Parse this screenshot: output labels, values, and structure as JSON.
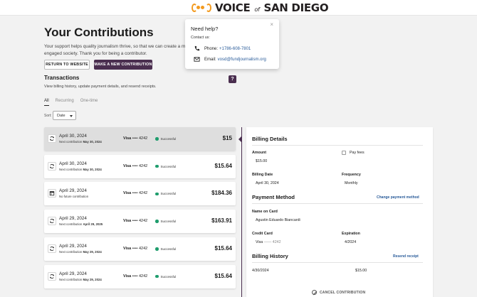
{
  "header": {
    "logo_text_main": "VOICE",
    "logo_text_of": "of",
    "logo_text_end": "SAN DIEGO"
  },
  "intro": {
    "title": "Your Contributions",
    "text": "Your support helps quality journalism thrive, so that we can create a m engaged society. Thank you for being a contributor.",
    "return_button": "RETURN TO WEBSITE",
    "new_button": "MAKE A NEW CONTRIBUTION"
  },
  "help_badge": "?",
  "transactions": {
    "title": "Transactions",
    "subtitle": "View billing history, update payment details, and resend receipts.",
    "tabs": [
      "All",
      "Recurring",
      "One-time"
    ],
    "sort_label": "Sort:",
    "sort_value": "Date",
    "rows": [
      {
        "icon": "recurring-icon",
        "date": "April 30, 2024",
        "next_prefix": "Next contribution",
        "next_date": "May 30, 2024",
        "card_brand": "Visa",
        "card_dots": "••••",
        "card_last4": "4242",
        "status": "Successful",
        "amount": "$15",
        "selected": true
      },
      {
        "icon": "recurring-icon",
        "date": "April 30, 2024",
        "next_prefix": "Next contribution",
        "next_date": "May 30, 2024",
        "card_brand": "Visa",
        "card_dots": "••••",
        "card_last4": "4242",
        "status": "Successful",
        "amount": "$15.64"
      },
      {
        "icon": "calendar-icon",
        "date": "April 29, 2024",
        "next_prefix": "No future contribution",
        "next_date": "",
        "card_brand": "Visa",
        "card_dots": "••••",
        "card_last4": "4242",
        "status": "Successful",
        "amount": "$184.36"
      },
      {
        "icon": "recurring-icon",
        "date": "April 29, 2024",
        "next_prefix": "Next contribution",
        "next_date": "April 29, 2025",
        "card_brand": "Visa",
        "card_dots": "••••",
        "card_last4": "4242",
        "status": "Successful",
        "amount": "$163.91"
      },
      {
        "icon": "recurring-icon",
        "date": "April 29, 2024",
        "next_prefix": "Next contribution",
        "next_date": "May 29, 2024",
        "card_brand": "Visa",
        "card_dots": "••••",
        "card_last4": "4242",
        "status": "Successful",
        "amount": "$15.64"
      },
      {
        "icon": "recurring-icon",
        "date": "April 29, 2024",
        "next_prefix": "Next contribution",
        "next_date": "May 29, 2024",
        "card_brand": "Visa",
        "card_dots": "••••",
        "card_last4": "4242",
        "status": "Successful",
        "amount": "$15.64"
      }
    ]
  },
  "details": {
    "billing_title": "Billing Details",
    "amount_label": "Amount",
    "amount_value": "$15.00",
    "pay_fees_label": "Pay fees",
    "billing_date_label": "Billing Date",
    "billing_date_value": "April 30, 2024",
    "frequency_label": "Frequency",
    "frequency_value": "Monthly",
    "payment_title": "Payment Method",
    "change_payment": "Change payment method",
    "name_label": "Name on Card",
    "name_value": "Agustin Eduardo Biancardi",
    "credit_card_label": "Credit Card",
    "credit_card_brand": "Visa",
    "credit_card_dash": "——",
    "credit_card_last4": "4242",
    "expiration_label": "Expiration",
    "expiration_value": "4/2024",
    "history_title": "Billing History",
    "resend_receipt": "Resend receipt",
    "history_date": "4/30/2024",
    "history_amount": "$15.00",
    "cancel_label": "CANCEL CONTRIBUTION"
  },
  "popup": {
    "title": "Need help?",
    "close": "×",
    "contact_label": "Contact us:",
    "phone_label": "Phone:",
    "phone_value": "+1786-608-7801",
    "email_label": "Email:",
    "email_value": "vosd@fundjournalism.org"
  },
  "colors": {
    "brand": "#4a2e4f",
    "logo_orange": "#f39a1e",
    "success": "#1f9d6d",
    "link": "#2a5c9a"
  }
}
